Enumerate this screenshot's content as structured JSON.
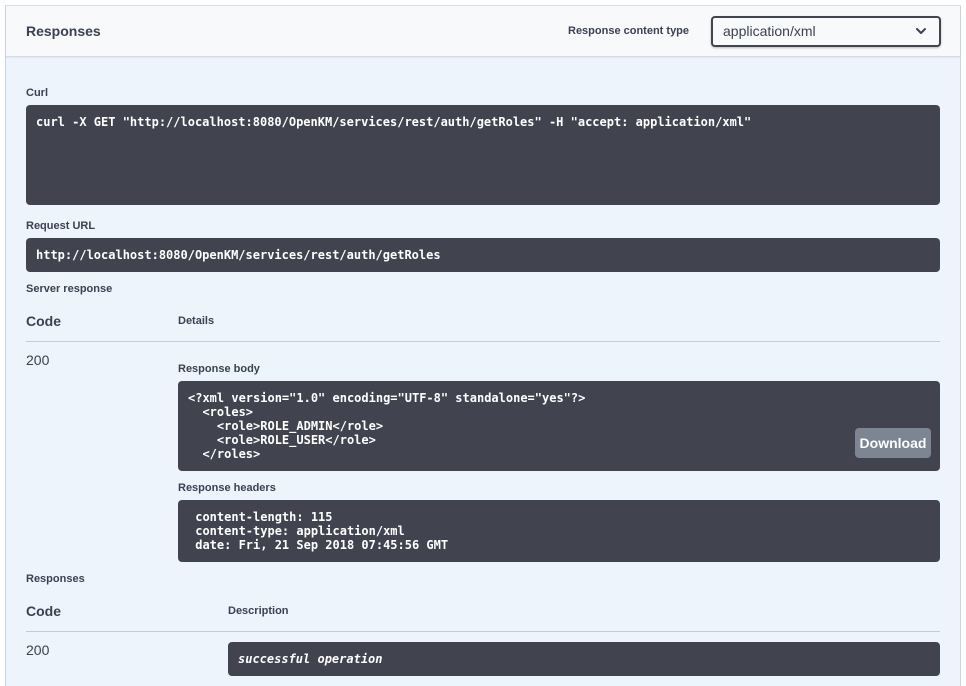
{
  "header": {
    "title": "Responses",
    "content_type_label": "Response content type",
    "content_type_value": "application/xml"
  },
  "curl": {
    "label": "Curl",
    "command": "curl -X GET \"http://localhost:8080/OpenKM/services/rest/auth/getRoles\" -H \"accept: application/xml\""
  },
  "request_url": {
    "label": "Request URL",
    "url": "http://localhost:8080/OpenKM/services/rest/auth/getRoles"
  },
  "server_response": {
    "label": "Server response",
    "code_header": "Code",
    "details_header": "Details",
    "code": "200",
    "body_label": "Response body",
    "body": "<?xml version=\"1.0\" encoding=\"UTF-8\" standalone=\"yes\"?>\n  <roles>\n    <role>ROLE_ADMIN</role>\n    <role>ROLE_USER</role>\n  </roles>",
    "download_label": "Download",
    "headers_label": "Response headers",
    "headers": " content-length: 115\n content-type: application/xml\n date: Fri, 21 Sep 2018 07:45:56 GMT"
  },
  "responses": {
    "label": "Responses",
    "code_header": "Code",
    "description_header": "Description",
    "code": "200",
    "description": "successful operation"
  },
  "icons": {
    "select_chevron": "chevron-down-icon"
  }
}
